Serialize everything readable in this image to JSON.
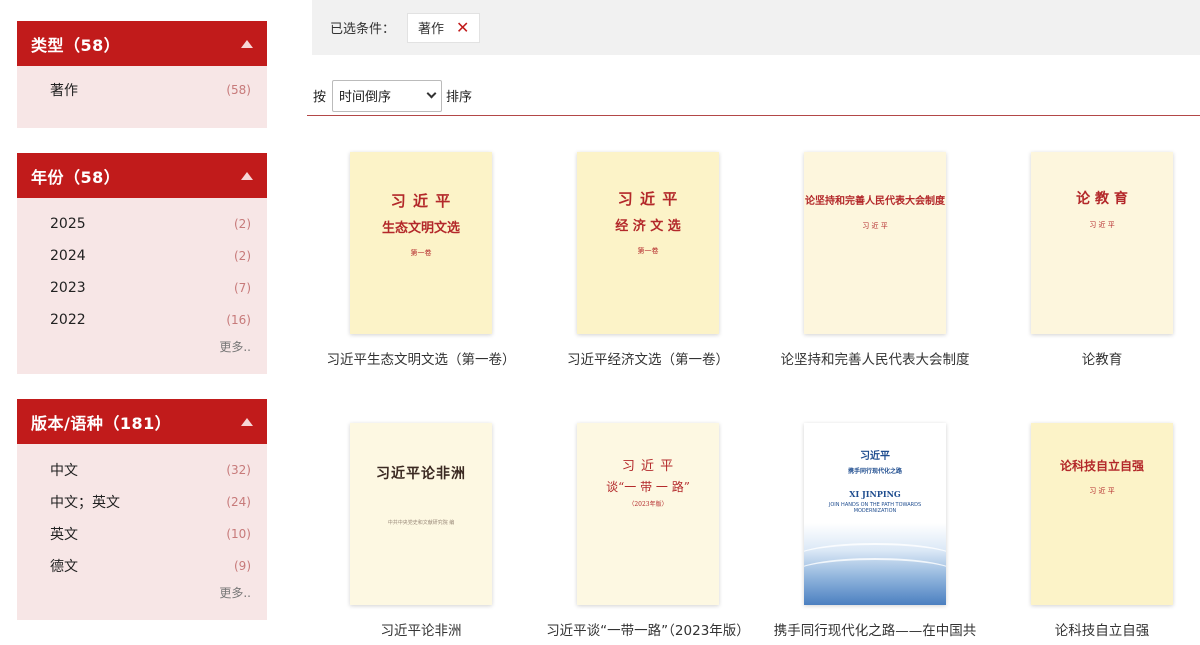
{
  "sidebar": {
    "facets": [
      {
        "title": "类型（58）",
        "items": [
          {
            "label": "著作",
            "count": "(58)"
          }
        ],
        "more": ""
      },
      {
        "title": "年份（58）",
        "items": [
          {
            "label": "2025",
            "count": "(2)"
          },
          {
            "label": "2024",
            "count": "(2)"
          },
          {
            "label": "2023",
            "count": "(7)"
          },
          {
            "label": "2022",
            "count": "(16)"
          }
        ],
        "more": "更多.."
      },
      {
        "title": "版本/语种（181）",
        "items": [
          {
            "label": "中文",
            "count": "(32)"
          },
          {
            "label": "中文；英文",
            "count": "(24)"
          },
          {
            "label": "英文",
            "count": "(10)"
          },
          {
            "label": "德文",
            "count": "(9)"
          }
        ],
        "more": "更多.."
      }
    ]
  },
  "filter_bar": {
    "label": "已选条件：",
    "chips": [
      {
        "label": "著作",
        "close_icon": "close-icon"
      }
    ],
    "close_color": "#c11b1b"
  },
  "sort_bar": {
    "prefix": "按",
    "selected": "时间倒序",
    "suffix": "排序"
  },
  "books": [
    {
      "title": "习近平生态文明文选（第一卷）",
      "cover_lines": [
        "习 近 平",
        "生态文明文选"
      ],
      "cover_sub": "第一卷"
    },
    {
      "title": "习近平经济文选（第一卷）",
      "cover_lines": [
        "习 近 平",
        "经 济 文 选"
      ],
      "cover_sub": "第一卷"
    },
    {
      "title": "论坚持和完善人民代表大会制度",
      "cover_lines": [
        "论坚持和完善人民代表大会制度"
      ],
      "cover_sub": "习 近 平"
    },
    {
      "title": "论教育",
      "cover_lines": [
        "论 教 育"
      ],
      "cover_sub": "习 近 平"
    },
    {
      "title": "习近平论非洲",
      "cover_lines": [
        "习近平论非洲"
      ],
      "cover_sub": "中共中央党史和文献研究院 编"
    },
    {
      "title": "习近平谈“一带一路”（2023年版）",
      "cover_lines": [
        "习 近 平",
        "谈“一 带 一 路”"
      ],
      "cover_sub": "（2023年版）"
    },
    {
      "title": "携手同行现代化之路——在中国共产党与世界政党高层对话会上的主旨讲话",
      "cover_lines": [
        "习近平",
        "携手同行现代化之路",
        "XI JINPING",
        "JOIN HANDS ON THE PATH TOWARDS MODERNIZATION"
      ],
      "cover_sub": ""
    },
    {
      "title": "论科技自立自强",
      "cover_lines": [
        "论科技自立自强"
      ],
      "cover_sub": "习 近 平"
    }
  ],
  "colors": {
    "accent": "#c11b1b",
    "facet_bg": "#f7e6e6",
    "count_color": "#c77a7a",
    "cover_yellow": "#fcf3c8"
  }
}
